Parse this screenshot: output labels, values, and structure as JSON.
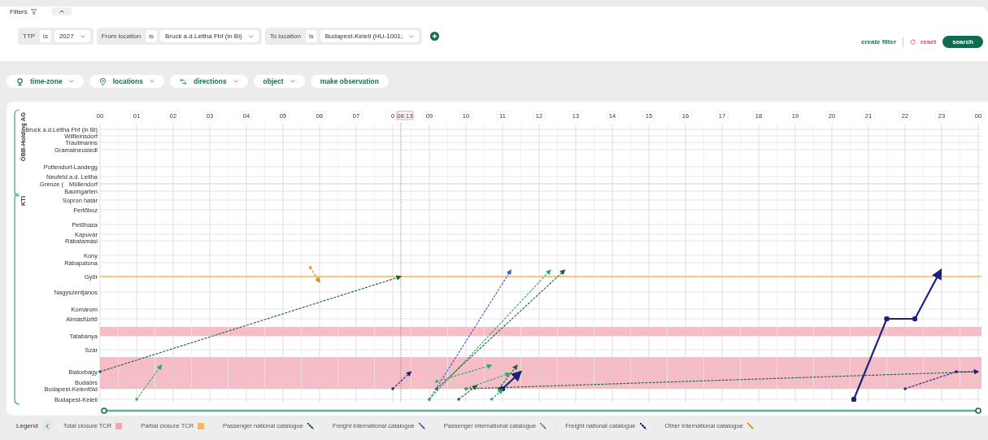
{
  "filters": {
    "title": "Filters",
    "chips": [
      {
        "field": "TTP",
        "operator": "is",
        "value": "2027"
      },
      {
        "field": "From location",
        "operator": "is",
        "value": "Bruck a.d.Leitha Fbf (in Bl)"
      },
      {
        "field": "To location",
        "operator": "is",
        "value": "Budapest-Keleti (HU-1001;"
      }
    ],
    "actions": {
      "create": "create filter",
      "reset": "reset",
      "search": "search"
    }
  },
  "toolbar": [
    {
      "label": "time-zone",
      "kind": "globe",
      "dropdown": true
    },
    {
      "label": "locations",
      "kind": "pin",
      "dropdown": true
    },
    {
      "label": "directions",
      "kind": "arrows",
      "dropdown": true
    },
    {
      "label": "object",
      "kind": "none",
      "dropdown": true
    },
    {
      "label": "make observation",
      "kind": "none",
      "dropdown": false
    }
  ],
  "chart": {
    "sections": [
      {
        "label": "ÖBB-Holding AG"
      },
      {
        "label": "KTI"
      }
    ],
    "hours": [
      "00",
      "01",
      "02",
      "03",
      "04",
      "05",
      "06",
      "07",
      "0",
      "09",
      "10",
      "11",
      "12",
      "13",
      "14",
      "15",
      "16",
      "17",
      "18",
      "19",
      "20",
      "21",
      "22",
      "23",
      "00"
    ],
    "now": "08:13",
    "stations": [
      "Bruck a.d.Leitha Fbf (in Bl)",
      "Wilfleinsdorf",
      "Trautmanns",
      "Gramatneusiedl",
      "Pottendorf-Landegg",
      "Neufeld a.d. Leitha",
      "Grenze (",
      "Müllendorf",
      "Baumgarten",
      "Sopron határ",
      "Fertőboz",
      "Petőháza",
      "Kapuvár",
      "Rábatamási",
      "Kóny",
      "Rábapatona",
      "Győr",
      "Nagyszentjános",
      "Komárom",
      "Almásfüzitő",
      "Tatabánya",
      "Szár",
      "Biatorbágy",
      "Budaörs",
      "Budapest-Kelenföld",
      "Budapest-Keleti"
    ]
  },
  "legend": {
    "title": "Legend",
    "items": [
      {
        "label": "Total closure TCR",
        "kind": "fill",
        "color": "#f4a7b3"
      },
      {
        "label": "Partial closure TCR",
        "kind": "fill",
        "color": "#f7b955"
      },
      {
        "label": "Passenger national catalogue",
        "kind": "line",
        "color": "#1e5e3e"
      },
      {
        "label": "Freight international catalogue",
        "kind": "line",
        "color": "#3a5fc8"
      },
      {
        "label": "Passenger international catalogue",
        "kind": "line",
        "color": "#2eaa6b"
      },
      {
        "label": "Freight national catalogue",
        "kind": "line",
        "color": "#1a237e"
      },
      {
        "label": "Other international catalogue",
        "kind": "line",
        "color": "#d98a1c"
      }
    ]
  }
}
